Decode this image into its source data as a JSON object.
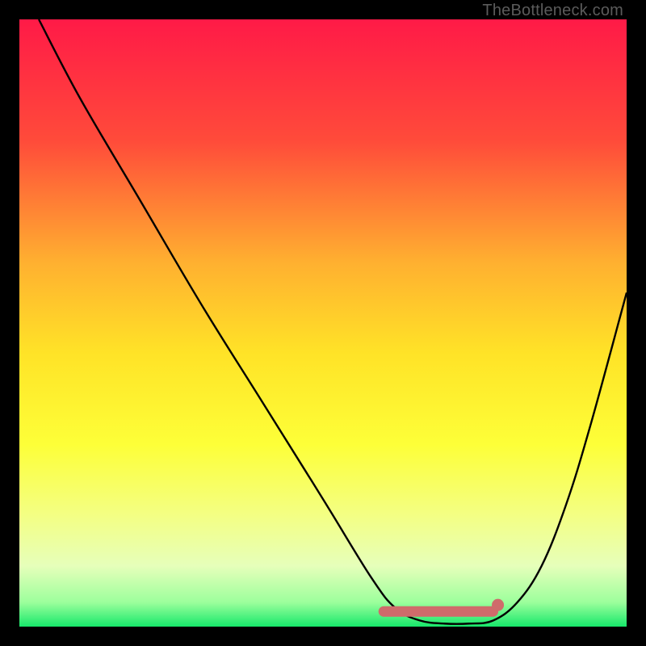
{
  "watermark": "TheBottleneck.com",
  "chart_data": {
    "type": "line",
    "title": "",
    "xlabel": "",
    "ylabel": "",
    "xlim": [
      0,
      100
    ],
    "ylim": [
      0,
      100
    ],
    "gradient_stops": [
      {
        "offset": 0,
        "color": "#ff1a47"
      },
      {
        "offset": 20,
        "color": "#ff4b3a"
      },
      {
        "offset": 40,
        "color": "#ffb030"
      },
      {
        "offset": 55,
        "color": "#ffe327"
      },
      {
        "offset": 70,
        "color": "#fdff38"
      },
      {
        "offset": 82,
        "color": "#f3ff86"
      },
      {
        "offset": 90,
        "color": "#e6ffba"
      },
      {
        "offset": 96,
        "color": "#9cff9c"
      },
      {
        "offset": 100,
        "color": "#17e86b"
      }
    ],
    "series": [
      {
        "name": "bottleneck-curve",
        "color": "#000000",
        "x": [
          3.2,
          10,
          20,
          30,
          40,
          50,
          58,
          62,
          66,
          70,
          74,
          78,
          82,
          86,
          90,
          94,
          100
        ],
        "values": [
          100,
          87,
          70,
          53,
          37,
          21,
          8,
          3,
          1,
          0.5,
          0.5,
          1,
          4,
          10,
          20,
          33,
          55
        ]
      }
    ],
    "marker_band": {
      "name": "optimal-range",
      "color": "#cf6b6b",
      "x_start": 60,
      "x_end": 78,
      "y": 2.5,
      "end_dot_radius_pct": 1.0
    }
  }
}
